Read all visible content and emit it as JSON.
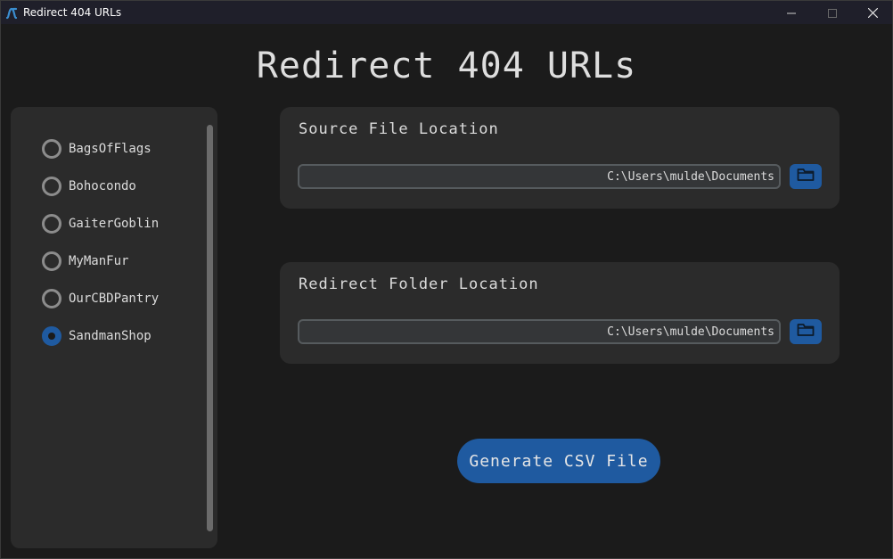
{
  "window": {
    "title": "Redirect 404 URLs",
    "app_icon": "app-logo-icon",
    "controls": {
      "minimize_icon": "minimize-icon",
      "maximize_icon": "maximize-icon",
      "close_icon": "close-icon"
    }
  },
  "page": {
    "title": "Redirect 404 URLs"
  },
  "sidebar": {
    "selected": "SandmanShop",
    "items": [
      {
        "label": "BagsOfFlags",
        "checked": false
      },
      {
        "label": "Bohocondo",
        "checked": false
      },
      {
        "label": "GaiterGoblin",
        "checked": false
      },
      {
        "label": "MyManFur",
        "checked": false
      },
      {
        "label": "OurCBDPantry",
        "checked": false
      },
      {
        "label": "SandmanShop",
        "checked": true
      }
    ]
  },
  "source": {
    "title": "Source File Location",
    "path": "C:\\Users\\mulde\\Documents",
    "browse_icon": "folder-icon"
  },
  "redirect": {
    "title": "Redirect Folder Location",
    "path": "C:\\Users\\mulde\\Documents",
    "browse_icon": "folder-icon"
  },
  "actions": {
    "generate_label": "Generate CSV File"
  },
  "colors": {
    "accent": "#1f5aa0",
    "background": "#1b1b1b",
    "panel": "#2b2b2b",
    "titlebar": "#1f1f2a"
  }
}
